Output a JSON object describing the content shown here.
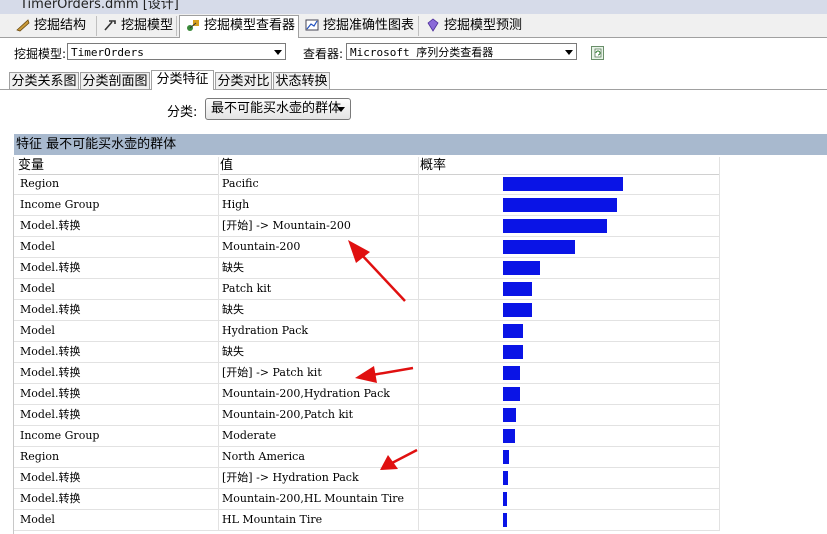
{
  "window": {
    "title": "TimerOrders.dmm [设计]"
  },
  "main_tabs": [
    {
      "label": "挖掘结构",
      "icon": "mining-structure-icon"
    },
    {
      "label": "挖掘模型",
      "icon": "mining-model-icon"
    },
    {
      "label": "挖掘模型查看器",
      "icon": "model-viewer-icon"
    },
    {
      "label": "挖掘准确性图表",
      "icon": "accuracy-chart-icon"
    },
    {
      "label": "挖掘模型预测",
      "icon": "prediction-icon"
    }
  ],
  "toolbar": {
    "model_label": "挖掘模型:",
    "model_value": "TimerOrders",
    "viewer_label": "查看器:",
    "viewer_value": "Microsoft 序列分类查看器"
  },
  "sub_tabs": [
    "分类关系图",
    "分类剖面图",
    "分类特征",
    "分类对比",
    "状态转换"
  ],
  "filter": {
    "label": "分类:",
    "value": "最不可能买水壶的群体"
  },
  "section_title": "特征 最不可能买水壶的群体",
  "columns": [
    "变量",
    "值",
    "概率"
  ],
  "rows": [
    {
      "variable": "Region",
      "value": "Pacific",
      "probability": 1.0
    },
    {
      "variable": "Income Group",
      "value": "High",
      "probability": 0.95
    },
    {
      "variable": "Model.转换",
      "value": "[开始] -> Mountain-200",
      "probability": 0.87
    },
    {
      "variable": "Model",
      "value": "Mountain-200",
      "probability": 0.6
    },
    {
      "variable": "Model.转换",
      "value": "缺失",
      "probability": 0.31
    },
    {
      "variable": "Model",
      "value": "Patch kit",
      "probability": 0.24
    },
    {
      "variable": "Model.转换",
      "value": "缺失",
      "probability": 0.24
    },
    {
      "variable": "Model",
      "value": "Hydration Pack",
      "probability": 0.17
    },
    {
      "variable": "Model.转换",
      "value": "缺失",
      "probability": 0.17
    },
    {
      "variable": "Model.转换",
      "value": "[开始] -> Patch kit",
      "probability": 0.14
    },
    {
      "variable": "Model.转换",
      "value": "Mountain-200,Hydration Pack",
      "probability": 0.14
    },
    {
      "variable": "Model.转换",
      "value": "Mountain-200,Patch kit",
      "probability": 0.11
    },
    {
      "variable": "Income Group",
      "value": "Moderate",
      "probability": 0.1
    },
    {
      "variable": "Region",
      "value": "North America",
      "probability": 0.05
    },
    {
      "variable": "Model.转换",
      "value": "[开始] -> Hydration Pack",
      "probability": 0.04
    },
    {
      "variable": "Model.转换",
      "value": "Mountain-200,HL Mountain Tire",
      "probability": 0.03
    },
    {
      "variable": "Model",
      "value": "HL Mountain Tire",
      "probability": 0.03
    }
  ],
  "colors": {
    "bar": "#0a14e6",
    "annotation_arrow": "#e01010",
    "section_header": "#a8b9ce"
  }
}
